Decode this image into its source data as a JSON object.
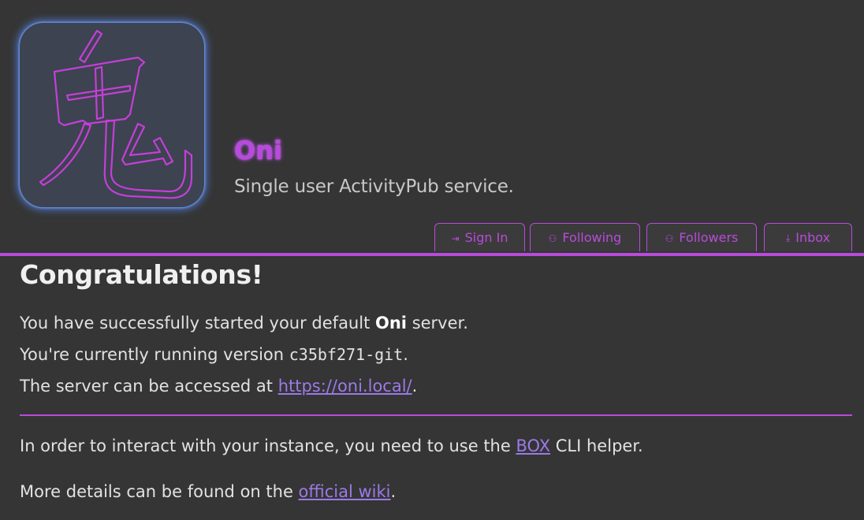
{
  "site": {
    "title": "Oni",
    "subtitle": "Single user ActivityPub service.",
    "logo_glyph": "鬼"
  },
  "nav": {
    "tabs": [
      {
        "label": "Sign In",
        "icon": "sign-in-icon"
      },
      {
        "label": "Following",
        "icon": "following-icon"
      },
      {
        "label": "Followers",
        "icon": "followers-icon"
      },
      {
        "label": "Inbox",
        "icon": "inbox-download-icon"
      }
    ]
  },
  "main": {
    "heading": "Congratulations!",
    "line1_prefix": "You have successfully started your default ",
    "line1_bold": "Oni",
    "line1_suffix": " server.",
    "line2_prefix": "You're currently running version ",
    "line2_version": "c35bf271-git",
    "line2_suffix": ".",
    "line3_prefix": "The server can be accessed at ",
    "line3_link": "https://oni.local/",
    "line3_suffix": ".",
    "line4_prefix": "In order to interact with your instance, you need to use the ",
    "line4_link": "BOX",
    "line4_suffix": " CLI helper.",
    "line5_prefix": "More details can be found on the ",
    "line5_link": "official wiki",
    "line5_suffix": "."
  },
  "colors": {
    "background": "#353535",
    "accent": "#b84bdb",
    "link": "#9b7ae8",
    "logo_glow": "#5a8cff"
  }
}
